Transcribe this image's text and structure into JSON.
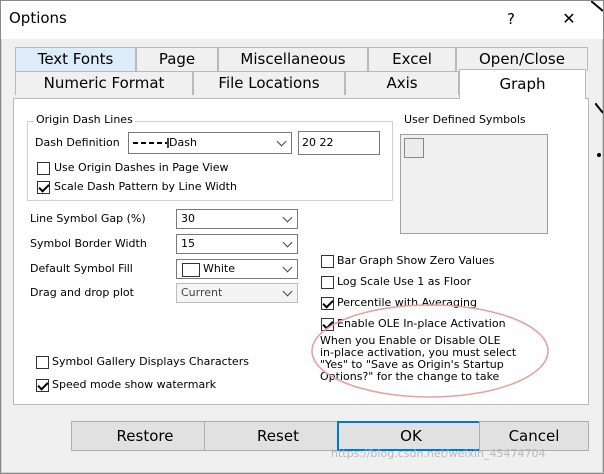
{
  "window": {
    "title": "Options",
    "help_label": "?",
    "close_label": "✕"
  },
  "tabs": {
    "row1": [
      "Text Fonts",
      "Page",
      "Miscellaneous",
      "Excel",
      "Open/Close"
    ],
    "row2": [
      "Numeric Format",
      "File Locations",
      "Axis",
      "Graph"
    ],
    "active": "Graph"
  },
  "graph": {
    "origin_dash_lines": {
      "group_label": "Origin Dash Lines",
      "dash_definition_label": "Dash Definition",
      "dash_definition_value": "Dash",
      "dash_definition_spec": "20 22",
      "use_origin_dashes": {
        "label": "Use Origin Dashes in Page View",
        "checked": false
      },
      "scale_dash_pattern": {
        "label": "Scale Dash Pattern by Line Width",
        "checked": true
      }
    },
    "user_defined_symbols": {
      "label": "User Defined Symbols"
    },
    "line_symbol_gap": {
      "label": "Line Symbol Gap (%)",
      "value": "30"
    },
    "symbol_border_width": {
      "label": "Symbol Border Width",
      "value": "15"
    },
    "default_symbol_fill": {
      "label": "Default Symbol Fill",
      "value": "White"
    },
    "drag_and_drop_plot": {
      "label": "Drag and drop plot",
      "value": "Current"
    },
    "bar_graph_zero": {
      "label": "Bar Graph Show Zero Values",
      "checked": false
    },
    "log_scale_floor": {
      "label": "Log Scale Use 1 as Floor",
      "checked": false
    },
    "percentile_averaging": {
      "label": "Percentile with Averaging",
      "checked": true
    },
    "enable_ole": {
      "label": "Enable OLE In-place Activation",
      "checked": true
    },
    "ole_note": [
      "When you Enable or Disable OLE",
      "in-place activation, you must select",
      "\"Yes\" to \"Save as Origin's Startup",
      "Options?\" for the change to take"
    ],
    "symbol_gallery": {
      "label": "Symbol Gallery Displays Characters",
      "checked": false
    },
    "speed_mode": {
      "label": "Speed mode show watermark",
      "checked": true
    }
  },
  "buttons": {
    "restore": "Restore",
    "reset": "Reset",
    "ok": "OK",
    "cancel": "Cancel"
  },
  "watermark": "https://blog.csdn.net/weixin_45474704",
  "colors": {
    "highlight_tab": "#dcecfb",
    "default_button_border": "#0078d7",
    "annotation_circle": "#e8a0a0"
  }
}
